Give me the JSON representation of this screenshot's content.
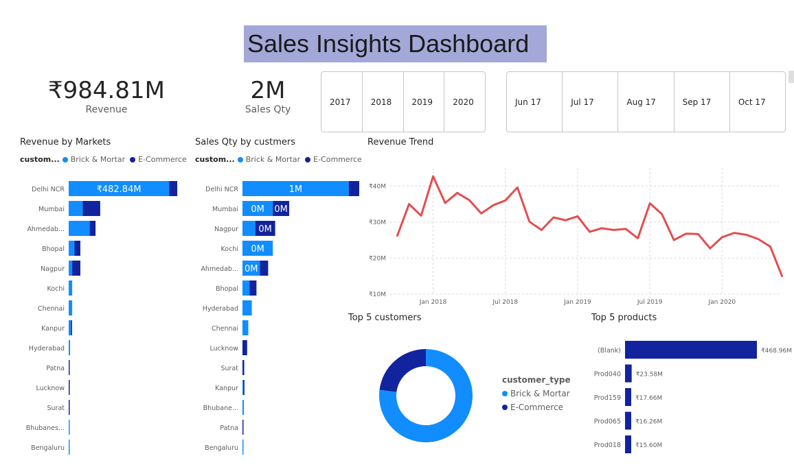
{
  "header": {
    "title": "Sales Insights Dashboard"
  },
  "kpis": [
    {
      "value": "₹984.81M",
      "label": "Revenue"
    },
    {
      "value": "2M",
      "label": "Sales Qty"
    }
  ],
  "year_slicer": [
    "2017",
    "2018",
    "2019",
    "2020"
  ],
  "month_slicer": [
    "Jun 17",
    "Jul 17",
    "Aug 17",
    "Sep 17",
    "Oct 17"
  ],
  "colors": {
    "brick_mortar": "#118dff",
    "ecommerce": "#12239e",
    "trend_line": "#e44c4f",
    "title_bg": "#a3a8d8"
  },
  "legend": {
    "title_short": "custom...",
    "title_full": "customer_type",
    "brick": "Brick & Mortar",
    "ecom": "E-Commerce"
  },
  "revenue_by_markets": {
    "title": "Revenue by Markets",
    "rows": [
      {
        "market": "Delhi NCR",
        "brick": 0.86,
        "ecom": 0.07,
        "label": "₹482.84M"
      },
      {
        "market": "Mumbai",
        "brick": 0.12,
        "ecom": 0.15,
        "label": ""
      },
      {
        "market": "Ahmedab...",
        "brick": 0.18,
        "ecom": 0.05,
        "label": ""
      },
      {
        "market": "Bhopal",
        "brick": 0.05,
        "ecom": 0.05,
        "label": ""
      },
      {
        "market": "Nagpur",
        "brick": 0.03,
        "ecom": 0.07,
        "label": ""
      },
      {
        "market": "Kochi",
        "brick": 0.03,
        "ecom": 0.0,
        "label": ""
      },
      {
        "market": "Chennai",
        "brick": 0.03,
        "ecom": 0.0,
        "label": ""
      },
      {
        "market": "Kanpur",
        "brick": 0.02,
        "ecom": 0.008,
        "label": ""
      },
      {
        "market": "Hyderabad",
        "brick": 0.012,
        "ecom": 0.0,
        "label": ""
      },
      {
        "market": "Patna",
        "brick": 0.0,
        "ecom": 0.008,
        "label": ""
      },
      {
        "market": "Lucknow",
        "brick": 0.0,
        "ecom": 0.006,
        "label": ""
      },
      {
        "market": "Surat",
        "brick": 0.0,
        "ecom": 0.005,
        "label": ""
      },
      {
        "market": "Bhubanes...",
        "brick": 0.003,
        "ecom": 0.0,
        "label": ""
      },
      {
        "market": "Bengaluru",
        "brick": 0.002,
        "ecom": 0.0,
        "label": ""
      }
    ]
  },
  "sales_qty_by_customers": {
    "title": "Sales Qty by custmers",
    "rows": [
      {
        "market": "Delhi NCR",
        "brick": 0.91,
        "ecom": 0.09,
        "label": "1M",
        "label2": ""
      },
      {
        "market": "Mumbai",
        "brick": 0.26,
        "ecom": 0.14,
        "label": "0M",
        "label2": "0M"
      },
      {
        "market": "Nagpur",
        "brick": 0.11,
        "ecom": 0.17,
        "label": "",
        "label2": "0M"
      },
      {
        "market": "Kochi",
        "brick": 0.26,
        "ecom": 0.0,
        "label": "0M",
        "label2": ""
      },
      {
        "market": "Ahmedab...",
        "brick": 0.15,
        "ecom": 0.07,
        "label": "0M",
        "label2": ""
      },
      {
        "market": "Bhopal",
        "brick": 0.06,
        "ecom": 0.06,
        "label": "",
        "label2": ""
      },
      {
        "market": "Hyderabad",
        "brick": 0.08,
        "ecom": 0.0,
        "label": "",
        "label2": ""
      },
      {
        "market": "Chennai",
        "brick": 0.05,
        "ecom": 0.0,
        "label": "",
        "label2": ""
      },
      {
        "market": "Lucknow",
        "brick": 0.0,
        "ecom": 0.04,
        "label": "",
        "label2": ""
      },
      {
        "market": "Surat",
        "brick": 0.0,
        "ecom": 0.015,
        "label": "",
        "label2": ""
      },
      {
        "market": "Kanpur",
        "brick": 0.008,
        "ecom": 0.008,
        "label": "",
        "label2": ""
      },
      {
        "market": "Bhubane...",
        "brick": 0.012,
        "ecom": 0.0,
        "label": "",
        "label2": ""
      },
      {
        "market": "Patna",
        "brick": 0.0,
        "ecom": 0.006,
        "label": "",
        "label2": ""
      },
      {
        "market": "Bengaluru",
        "brick": 0.002,
        "ecom": 0.0,
        "label": "",
        "label2": ""
      }
    ]
  },
  "revenue_trend": {
    "title": "Revenue Trend",
    "y_ticks": [
      "₹40M",
      "₹30M",
      "₹20M",
      "₹10M"
    ],
    "x_ticks": [
      "Jan 2018",
      "Jul 2018",
      "Jan 2019",
      "Jul 2019",
      "Jan 2020"
    ]
  },
  "top_customers": {
    "title": "Top 5 customers",
    "legend_title": "customer_type",
    "brick_share": 0.77,
    "ecom_share": 0.23
  },
  "top_products": {
    "title": "Top 5 products",
    "rows": [
      {
        "name": "(Blank)",
        "value": 468.96,
        "label": "₹468.96M"
      },
      {
        "name": "Prod040",
        "value": 23.58,
        "label": "₹23.58M"
      },
      {
        "name": "Prod159",
        "value": 17.66,
        "label": "₹17.66M"
      },
      {
        "name": "Prod065",
        "value": 16.26,
        "label": "₹16.26M"
      },
      {
        "name": "Prod018",
        "value": 15.6,
        "label": "₹15.60M"
      }
    ]
  },
  "chart_data": {
    "type": "line",
    "title": "Revenue Trend",
    "x": [
      "Oct 2017",
      "Nov 2017",
      "Dec 2017",
      "Jan 2018",
      "Feb 2018",
      "Mar 2018",
      "Apr 2018",
      "May 2018",
      "Jun 2018",
      "Jul 2018",
      "Aug 2018",
      "Sep 2018",
      "Oct 2018",
      "Nov 2018",
      "Dec 2018",
      "Jan 2019",
      "Feb 2019",
      "Mar 2019",
      "Apr 2019",
      "May 2019",
      "Jun 2019",
      "Jul 2019",
      "Aug 2019",
      "Sep 2019",
      "Oct 2019",
      "Nov 2019",
      "Dec 2019",
      "Jan 2020",
      "Feb 2020",
      "Mar 2020",
      "Apr 2020",
      "May 2020",
      "Jun 2020"
    ],
    "series": [
      {
        "values": [
          26,
          35,
          31.8,
          42.7,
          35.3,
          38.1,
          36.1,
          32.4,
          34.7,
          36.0,
          39.6,
          30.1,
          27.8,
          31.3,
          30.5,
          31.6,
          27.3,
          28.3,
          27.8,
          28.1,
          25.5,
          35.2,
          32.2,
          25.0,
          26.8,
          26.7,
          22.7,
          25.8,
          27.0,
          26.5,
          25.3,
          23.2,
          14.8
        ]
      }
    ],
    "ylim": [
      10,
      45
    ],
    "y_ticks": [
      "₹40M",
      "₹30M",
      "₹20M",
      "₹10M"
    ],
    "x_ticks": [
      "Jan 2018",
      "Jul 2018",
      "Jan 2019",
      "Jul 2019",
      "Jan 2020"
    ],
    "grid": true
  }
}
